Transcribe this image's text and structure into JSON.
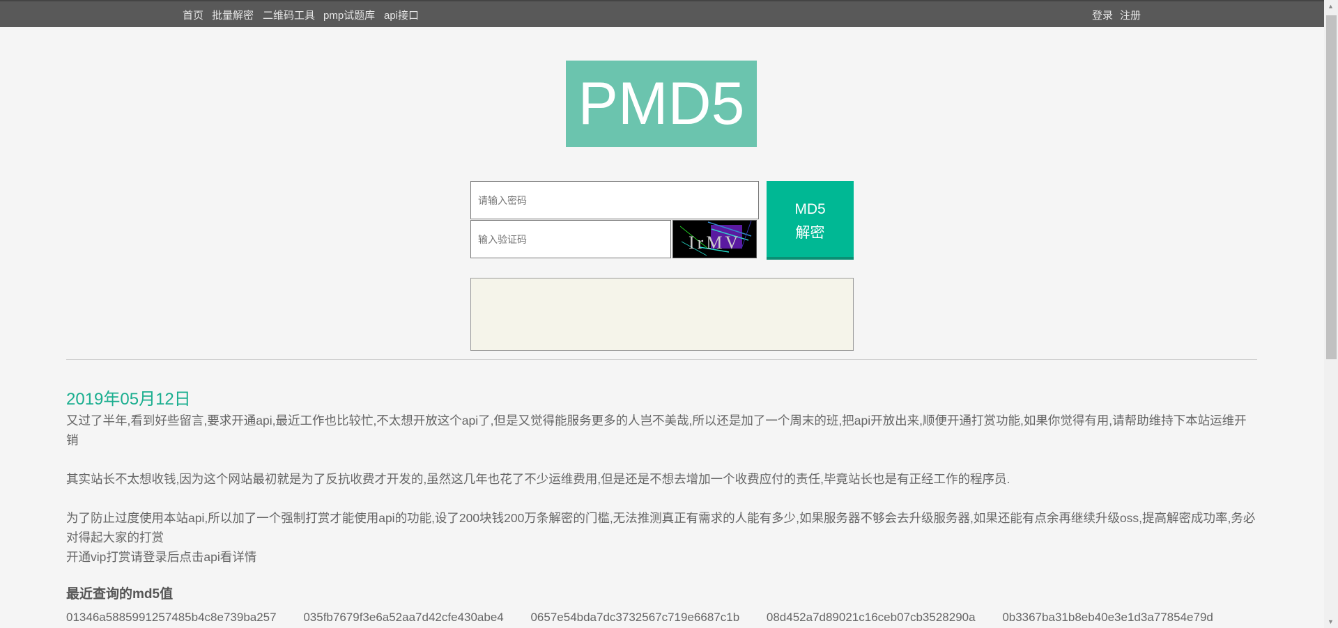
{
  "nav": {
    "left": [
      "首页",
      "批量解密",
      "二维码工具",
      "pmp试题库",
      "api接口"
    ],
    "right": [
      "登录",
      "注册"
    ]
  },
  "logo": "PMD5",
  "form": {
    "password_placeholder": "请输入密码",
    "captcha_placeholder": "输入验证码",
    "captcha_text": "IrMV",
    "submit_line1": "MD5",
    "submit_line2": "解密"
  },
  "notice": {
    "date": "2019年05月12日",
    "paragraphs": [
      "又过了半年,看到好些留言,要求开通api,最近工作也比较忙,不太想开放这个api了,但是又觉得能服务更多的人岂不美哉,所以还是加了一个周末的班,把api开放出来,顺便开通打赏功能,如果你觉得有用,请帮助维持下本站运维开销",
      "其实站长不太想收钱,因为这个网站最初就是为了反抗收费才开发的,虽然这几年也花了不少运维费用,但是还是不想去增加一个收费应付的责任,毕竟站长也是有正经工作的程序员.",
      "为了防止过度使用本站api,所以加了一个强制打赏才能使用api的功能,设了200块钱200万条解密的门槛,无法推测真正有需求的人能有多少,如果服务器不够会去升级服务器,如果还能有点余再继续升级oss,提高解密成功率,务必对得起大家的打赏",
      "开通vip打赏请登录后点击api看详情"
    ]
  },
  "recent": {
    "title": "最近查询的md5值",
    "hashes": [
      "01346a5885991257485b4c8e739ba257",
      "035fb7679f3e6a52aa7d42cfe430abe4",
      "0657e54bda7dc3732567c719e6687c1b",
      "08d452a7d89021c16ceb07cb3528290a",
      "0b3367ba31b8eb40e3e1d3a77854e79d"
    ]
  },
  "colors": {
    "nav": "#595959",
    "accent": "#00b894",
    "logo": "#6bc4ae"
  }
}
